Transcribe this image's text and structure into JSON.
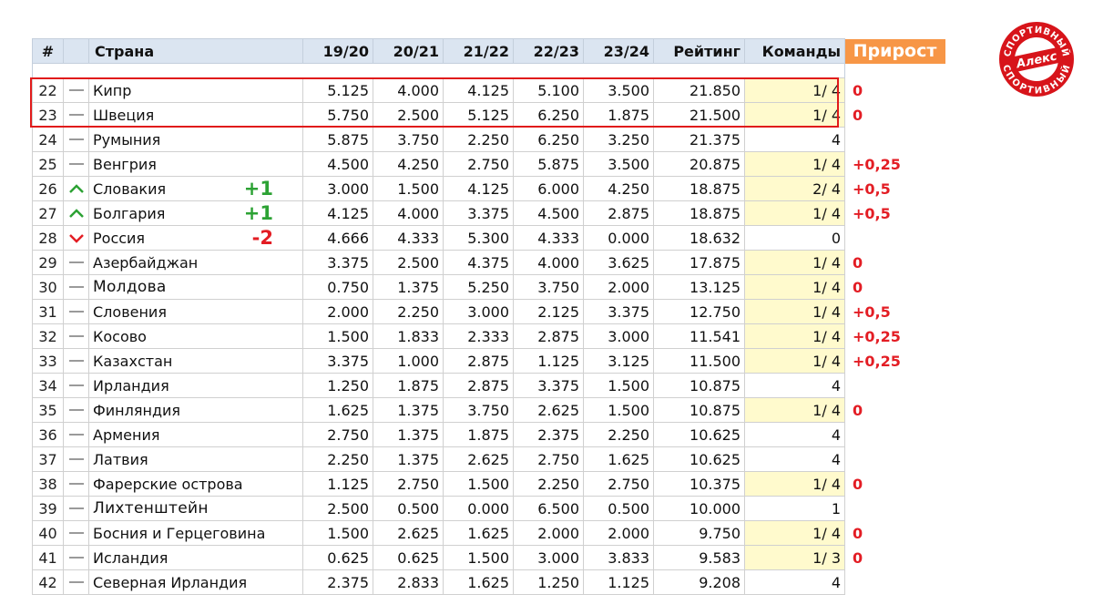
{
  "headers": {
    "num": "#",
    "trend": "",
    "country": "Страна",
    "s1920": "19/20",
    "s2021": "20/21",
    "s2122": "21/22",
    "s2223": "22/23",
    "s2324": "23/24",
    "rating": "Рейтинг",
    "teams": "Команды",
    "growth": "Прирост"
  },
  "rows": [
    {
      "num": "22",
      "trend": "same",
      "country": "Кипр",
      "change": "",
      "s1920": "5.125",
      "s2021": "4.000",
      "s2122": "4.125",
      "s2223": "5.100",
      "s2324": "3.500",
      "rating": "21.850",
      "teams": "1/ 4",
      "teams_highlight": true,
      "growth": "0"
    },
    {
      "num": "23",
      "trend": "same",
      "country": "Швеция",
      "change": "",
      "s1920": "5.750",
      "s2021": "2.500",
      "s2122": "5.125",
      "s2223": "6.250",
      "s2324": "1.875",
      "rating": "21.500",
      "teams": "1/ 4",
      "teams_highlight": true,
      "growth": "0"
    },
    {
      "num": "24",
      "trend": "same",
      "country": "Румыния",
      "change": "",
      "s1920": "5.875",
      "s2021": "3.750",
      "s2122": "2.250",
      "s2223": "6.250",
      "s2324": "3.250",
      "rating": "21.375",
      "teams": "4",
      "teams_highlight": false,
      "growth": ""
    },
    {
      "num": "25",
      "trend": "same",
      "country": "Венгрия",
      "change": "",
      "s1920": "4.500",
      "s2021": "4.250",
      "s2122": "2.750",
      "s2223": "5.875",
      "s2324": "3.500",
      "rating": "20.875",
      "teams": "1/ 4",
      "teams_highlight": true,
      "growth": "+0,25"
    },
    {
      "num": "26",
      "trend": "up",
      "country": "Словакия",
      "change": "+1",
      "s1920": "3.000",
      "s2021": "1.500",
      "s2122": "4.125",
      "s2223": "6.000",
      "s2324": "4.250",
      "rating": "18.875",
      "teams": "2/ 4",
      "teams_highlight": true,
      "growth": "+0,5"
    },
    {
      "num": "27",
      "trend": "up",
      "country": "Болгария",
      "change": "+1",
      "s1920": "4.125",
      "s2021": "4.000",
      "s2122": "3.375",
      "s2223": "4.500",
      "s2324": "2.875",
      "rating": "18.875",
      "teams": "1/ 4",
      "teams_highlight": true,
      "growth": "+0,5"
    },
    {
      "num": "28",
      "trend": "down",
      "country": "Россия",
      "change": "-2",
      "s1920": "4.666",
      "s2021": "4.333",
      "s2122": "5.300",
      "s2223": "4.333",
      "s2324": "0.000",
      "rating": "18.632",
      "teams": "0",
      "teams_highlight": false,
      "growth": ""
    },
    {
      "num": "29",
      "trend": "same",
      "country": "Азербайджан",
      "change": "",
      "s1920": "3.375",
      "s2021": "2.500",
      "s2122": "4.375",
      "s2223": "4.000",
      "s2324": "3.625",
      "rating": "17.875",
      "teams": "1/ 4",
      "teams_highlight": true,
      "growth": "0"
    },
    {
      "num": "30",
      "trend": "same",
      "country": "Молдова",
      "change": "",
      "s1920": "0.750",
      "s2021": "1.375",
      "s2122": "5.250",
      "s2223": "3.750",
      "s2324": "2.000",
      "rating": "13.125",
      "teams": "1/ 4",
      "teams_highlight": true,
      "growth": "0"
    },
    {
      "num": "31",
      "trend": "same",
      "country": "Словения",
      "change": "",
      "s1920": "2.000",
      "s2021": "2.250",
      "s2122": "3.000",
      "s2223": "2.125",
      "s2324": "3.375",
      "rating": "12.750",
      "teams": "1/ 4",
      "teams_highlight": true,
      "growth": "+0,5"
    },
    {
      "num": "32",
      "trend": "same",
      "country": "Косово",
      "change": "",
      "s1920": "1.500",
      "s2021": "1.833",
      "s2122": "2.333",
      "s2223": "2.875",
      "s2324": "3.000",
      "rating": "11.541",
      "teams": "1/ 4",
      "teams_highlight": true,
      "growth": "+0,25"
    },
    {
      "num": "33",
      "trend": "same",
      "country": "Казахстан",
      "change": "",
      "s1920": "3.375",
      "s2021": "1.000",
      "s2122": "2.875",
      "s2223": "1.125",
      "s2324": "3.125",
      "rating": "11.500",
      "teams": "1/ 4",
      "teams_highlight": true,
      "growth": "+0,25"
    },
    {
      "num": "34",
      "trend": "same",
      "country": "Ирландия",
      "change": "",
      "s1920": "1.250",
      "s2021": "1.875",
      "s2122": "2.875",
      "s2223": "3.375",
      "s2324": "1.500",
      "rating": "10.875",
      "teams": "4",
      "teams_highlight": false,
      "growth": ""
    },
    {
      "num": "35",
      "trend": "same",
      "country": "Финляндия",
      "change": "",
      "s1920": "1.625",
      "s2021": "1.375",
      "s2122": "3.750",
      "s2223": "2.625",
      "s2324": "1.500",
      "rating": "10.875",
      "teams": "1/ 4",
      "teams_highlight": true,
      "growth": "0"
    },
    {
      "num": "36",
      "trend": "same",
      "country": "Армения",
      "change": "",
      "s1920": "2.750",
      "s2021": "1.375",
      "s2122": "1.875",
      "s2223": "2.375",
      "s2324": "2.250",
      "rating": "10.625",
      "teams": "4",
      "teams_highlight": false,
      "growth": ""
    },
    {
      "num": "37",
      "trend": "same",
      "country": "Латвия",
      "change": "",
      "s1920": "2.250",
      "s2021": "1.375",
      "s2122": "2.625",
      "s2223": "2.750",
      "s2324": "1.625",
      "rating": "10.625",
      "teams": "4",
      "teams_highlight": false,
      "growth": ""
    },
    {
      "num": "38",
      "trend": "same",
      "country": "Фарерские острова",
      "change": "",
      "s1920": "1.125",
      "s2021": "2.750",
      "s2122": "1.500",
      "s2223": "2.250",
      "s2324": "2.750",
      "rating": "10.375",
      "teams": "1/ 4",
      "teams_highlight": true,
      "growth": "0"
    },
    {
      "num": "39",
      "trend": "same",
      "country": "Лихтенштейн",
      "change": "",
      "s1920": "2.500",
      "s2021": "0.500",
      "s2122": "0.000",
      "s2223": "6.500",
      "s2324": "0.500",
      "rating": "10.000",
      "teams": "1",
      "teams_highlight": false,
      "growth": ""
    },
    {
      "num": "40",
      "trend": "same",
      "country": "Босния и Герцеговина",
      "change": "",
      "s1920": "1.500",
      "s2021": "2.625",
      "s2122": "1.625",
      "s2223": "2.000",
      "s2324": "2.000",
      "rating": "9.750",
      "teams": "1/ 4",
      "teams_highlight": true,
      "growth": "0"
    },
    {
      "num": "41",
      "trend": "same",
      "country": "Исландия",
      "change": "",
      "s1920": "0.625",
      "s2021": "0.625",
      "s2122": "1.500",
      "s2223": "3.000",
      "s2324": "3.833",
      "rating": "9.583",
      "teams": "1/ 3",
      "teams_highlight": true,
      "growth": "0"
    },
    {
      "num": "42",
      "trend": "same",
      "country": "Северная Ирландия",
      "change": "",
      "s1920": "2.375",
      "s2021": "2.833",
      "s2122": "1.625",
      "s2223": "1.250",
      "s2324": "1.125",
      "rating": "9.208",
      "teams": "4",
      "teams_highlight": false,
      "growth": ""
    }
  ],
  "logo": {
    "top_text": "СПОРТИВНЫЙ",
    "center_text": "Алекс",
    "bottom_text": "СПОРТИВНЫЙ"
  },
  "colors": {
    "header_bg": "#dbe5f1",
    "growth_header_bg": "#f79646",
    "highlight_border": "#e11b1b",
    "teams_highlight_bg": "#fffacd",
    "growth_text": "#e31d24",
    "change_up": "#2ca234",
    "change_down": "#e31d24",
    "logo_red": "#d7141a"
  }
}
